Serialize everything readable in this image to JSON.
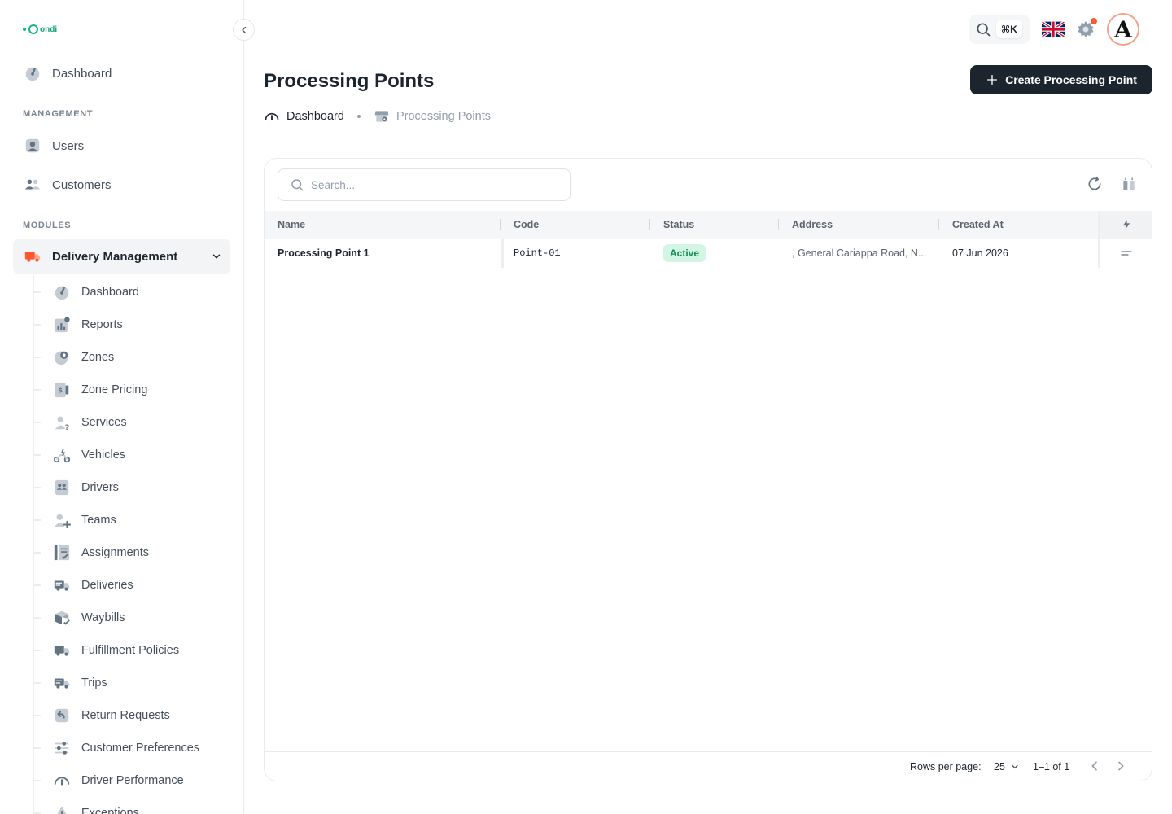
{
  "brand": {
    "logo_text": "ondi",
    "accent": "#12b886"
  },
  "sidebar": {
    "top_item": {
      "label": "Dashboard",
      "icon": "dashboard-icon"
    },
    "management_label": "MANAGEMENT",
    "management_items": [
      {
        "label": "Users",
        "icon": "user-icon"
      },
      {
        "label": "Customers",
        "icon": "customers-icon"
      }
    ],
    "modules_label": "MODULES",
    "active_module": {
      "label": "Delivery Management",
      "icon": "delivery-truck-icon",
      "expanded": true
    },
    "sub_items": [
      {
        "label": "Dashboard",
        "icon": "dashboard-icon"
      },
      {
        "label": "Reports",
        "icon": "reports-icon"
      },
      {
        "label": "Zones",
        "icon": "zones-icon"
      },
      {
        "label": "Zone Pricing",
        "icon": "pricing-icon"
      },
      {
        "label": "Services",
        "icon": "services-icon"
      },
      {
        "label": "Vehicles",
        "icon": "vehicles-icon"
      },
      {
        "label": "Drivers",
        "icon": "drivers-icon"
      },
      {
        "label": "Teams",
        "icon": "teams-icon"
      },
      {
        "label": "Assignments",
        "icon": "assignments-icon"
      },
      {
        "label": "Deliveries",
        "icon": "deliveries-icon"
      },
      {
        "label": "Waybills",
        "icon": "waybills-icon"
      },
      {
        "label": "Fulfillment Policies",
        "icon": "fulfillment-icon"
      },
      {
        "label": "Trips",
        "icon": "trips-icon"
      },
      {
        "label": "Return Requests",
        "icon": "return-icon"
      },
      {
        "label": "Customer Preferences",
        "icon": "preferences-icon"
      },
      {
        "label": "Driver Performance",
        "icon": "performance-icon"
      },
      {
        "label": "Exceptions",
        "icon": "exceptions-icon"
      }
    ]
  },
  "header": {
    "shortcut": "⌘K",
    "language_icon": "uk-flag-icon",
    "notification_dot_color": "#ff5630",
    "avatar_letter": "A"
  },
  "page": {
    "title": "Processing Points",
    "create_label": "Create Processing Point",
    "breadcrumb": [
      {
        "label": "Dashboard",
        "icon": "dashboard-icon"
      },
      {
        "label": "Processing Points",
        "icon": "store-icon"
      }
    ]
  },
  "table": {
    "search_placeholder": "Search...",
    "columns": [
      "Name",
      "Code",
      "Status",
      "Address",
      "Created At"
    ],
    "rows": [
      {
        "name": "Processing Point 1",
        "code": "Point-01",
        "status": "Active",
        "address": ", General Cariappa Road, N...",
        "created_at": "07 Jun 2026"
      }
    ],
    "status_colors": {
      "active_bg": "#d3f5e4",
      "active_text": "#118d57"
    },
    "footer": {
      "rows_per_page_label": "Rows per page:",
      "rows_per_page": "25",
      "range": "1–1 of 1"
    }
  }
}
